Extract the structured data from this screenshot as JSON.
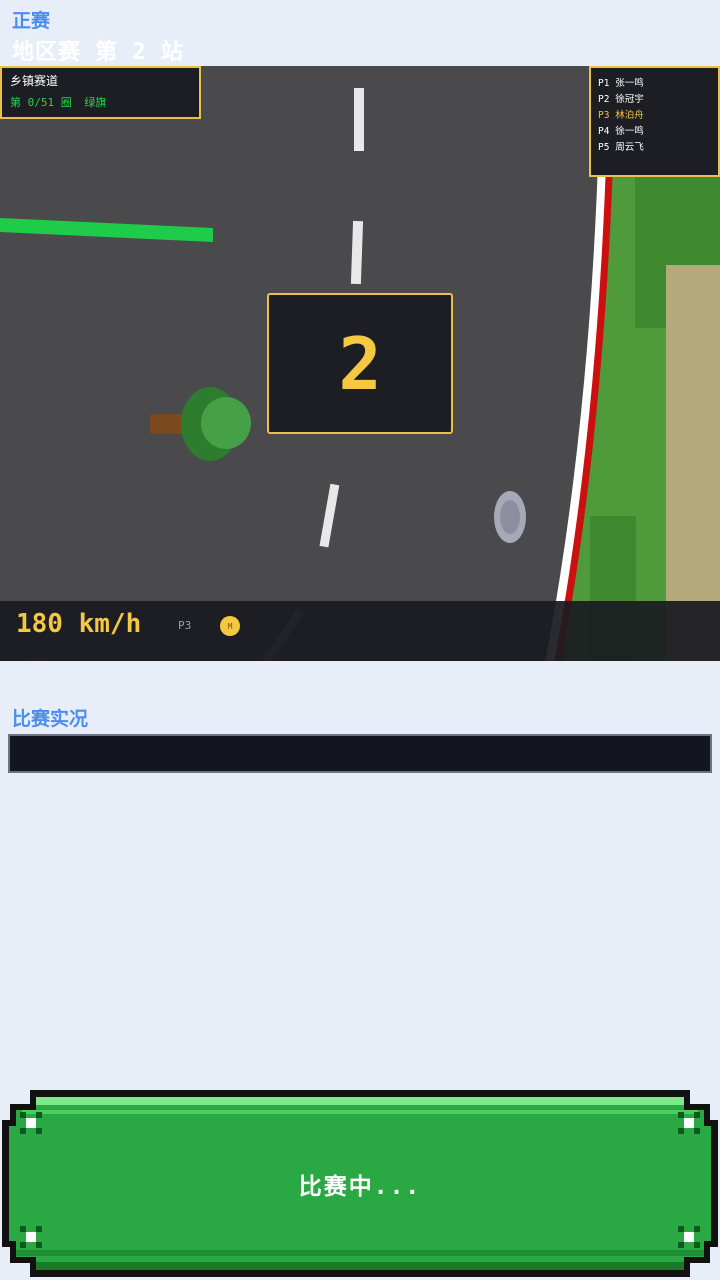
{
  "header": {
    "mode": "正赛",
    "event": "地区赛 第 2 站"
  },
  "race": {
    "track_name": "乡镇赛道",
    "lap": "第 0/51 圈",
    "flag": "绿旗",
    "countdown": "2",
    "speed": "180 km/h",
    "position": "P3",
    "medal": "M",
    "standings": [
      {
        "pos": "P1",
        "name": "张一鸣"
      },
      {
        "pos": "P2",
        "name": "徐冠宇"
      },
      {
        "pos": "P3",
        "name": "林泊舟"
      },
      {
        "pos": "P4",
        "name": "徐一鸣"
      },
      {
        "pos": "P5",
        "name": "周云飞"
      }
    ]
  },
  "commentary": {
    "title": "比赛实况",
    "text": ""
  },
  "status_button": {
    "label": "比赛中..."
  },
  "colors": {
    "accent": "#4a8ef0",
    "panel_border": "#e8c04a",
    "highlight": "#f5c842",
    "flag_green": "#2ed04a",
    "button_green": "#2db84a"
  }
}
